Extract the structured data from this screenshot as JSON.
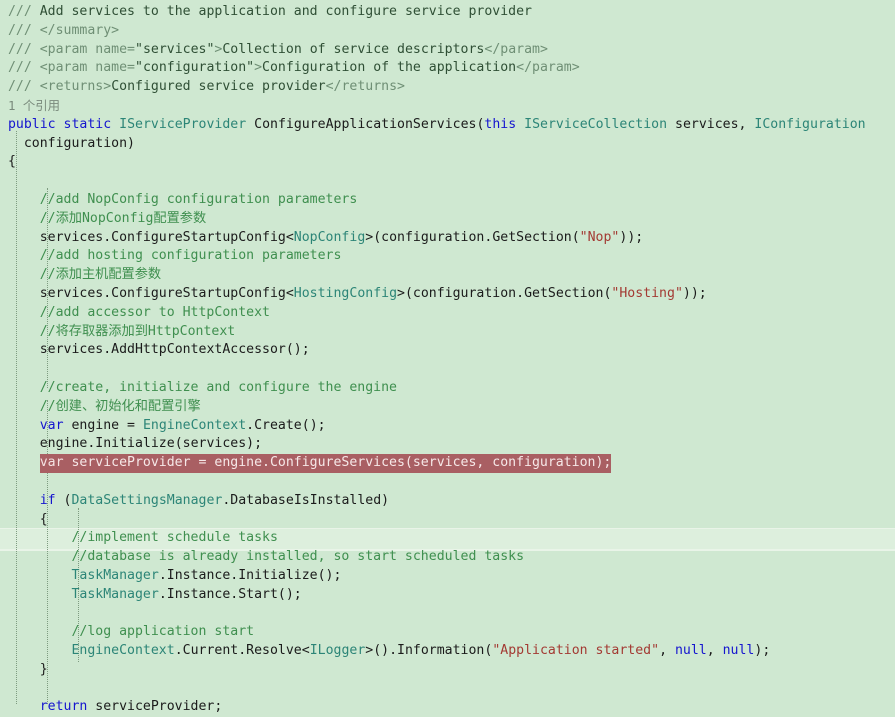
{
  "editor": {
    "background_color": "#cfe8d1",
    "selection_color": "#a95f63",
    "codelens": "1 个引用",
    "colors": {
      "keyword": "#1515cf",
      "type": "#2c8577",
      "comment": "#3f8f4f",
      "string": "#a33a33",
      "doc_comment": "#6f8f75",
      "plain": "#1b1b1b",
      "selection_bg": "#a95f63",
      "band": "#ddefdd"
    }
  },
  "code": {
    "l01_doc_slash": "/// ",
    "l01_text": "Add services to the application and configure service provider",
    "l02_doc_slash": "/// ",
    "l02_tag": "</summary>",
    "l03_doc_slash": "/// ",
    "l03_tag_open": "<param name=",
    "l03_attr": "\"services\"",
    "l03_gt": ">",
    "l03_text": "Collection of service descriptors",
    "l03_tag_close": "</param>",
    "l04_doc_slash": "/// ",
    "l04_tag_open": "<param name=",
    "l04_attr": "\"configuration\"",
    "l04_gt": ">",
    "l04_text": "Configuration of the application",
    "l04_tag_close": "</param>",
    "l05_doc_slash": "/// ",
    "l05_tag_open": "<returns>",
    "l05_text": "Configured service provider",
    "l05_tag_close": "</returns>",
    "l06_codelens": "1 个引用",
    "l07_kw_public": "public",
    "l07_kw_static": "static",
    "l07_ret_type": "IServiceProvider",
    "l07_method": "ConfigureApplicationServices",
    "l07_paren": "(",
    "l07_kw_this": "this",
    "l07_p1_type": "IServiceCollection",
    "l07_p1_name": "services",
    "l07_comma": ", ",
    "l07_p2_type": "IConfiguration",
    "l08_p2_name": "configuration)",
    "l09_brace": "{",
    "l10_comment": "//add NopConfig configuration parameters",
    "l11_comment": "//添加NopConfig配置参数",
    "l12_a": "services.",
    "l12_b": "ConfigureStartupConfig",
    "l12_lt": "<",
    "l12_generic": "NopConfig",
    "l12_gt": ">(",
    "l12_c": "configuration.",
    "l12_d": "GetSection",
    "l12_e": "(",
    "l12_str": "\"Nop\"",
    "l12_f": "));",
    "l13_comment": "//add hosting configuration parameters",
    "l14_comment": "//添加主机配置参数",
    "l15_a": "services.",
    "l15_b": "ConfigureStartupConfig",
    "l15_lt": "<",
    "l15_generic": "HostingConfig",
    "l15_gt": ">(",
    "l15_c": "configuration.",
    "l15_d": "GetSection",
    "l15_e": "(",
    "l15_str": "\"Hosting\"",
    "l15_f": "));",
    "l16_comment": "//add accessor to HttpContext",
    "l17_comment": "//将存取器添加到HttpContext",
    "l18_a": "services.",
    "l18_b": "AddHttpContextAccessor",
    "l18_c": "();",
    "l20_comment": "//create, initialize and configure the engine",
    "l21_comment": "//创建、初始化和配置引擎",
    "l22_kw_var": "var",
    "l22_name": " engine = ",
    "l22_type": "EngineContext",
    "l22_dot": ".",
    "l22_call": "Create",
    "l22_tail": "();",
    "l23_a": "engine.",
    "l23_b": "Initialize",
    "l23_c": "(services);",
    "l24_selected_kw": "var",
    "l24_selected_rest": " serviceProvider = engine.ConfigureServices(services, configuration);",
    "l26_kw_if": "if",
    "l26_open": " (",
    "l26_type": "DataSettingsManager",
    "l26_dot": ".",
    "l26_member": "DatabaseIsInstalled",
    "l26_close": ")",
    "l27_brace": "{",
    "l28_comment": "//implement schedule tasks",
    "l29_comment": "//database is already installed, so start scheduled tasks",
    "l30_type": "TaskManager",
    "l30_rest": ".Instance.Initialize();",
    "l31_type": "TaskManager",
    "l31_rest": ".Instance.Start();",
    "l33_comment": "//log application start",
    "l34_type": "EngineContext",
    "l34_mid": ".Current.Resolve",
    "l34_lt": "<",
    "l34_generic": "ILogger",
    "l34_gt": ">().",
    "l34_info": "Information",
    "l34_paren": "(",
    "l34_str": "\"Application started\"",
    "l34_comma1": ", ",
    "l34_null1": "null",
    "l34_comma2": ", ",
    "l34_null2": "null",
    "l34_tail": ");",
    "l35_brace": "}",
    "l37_kw_return": "return",
    "l37_rest": " serviceProvider;"
  }
}
